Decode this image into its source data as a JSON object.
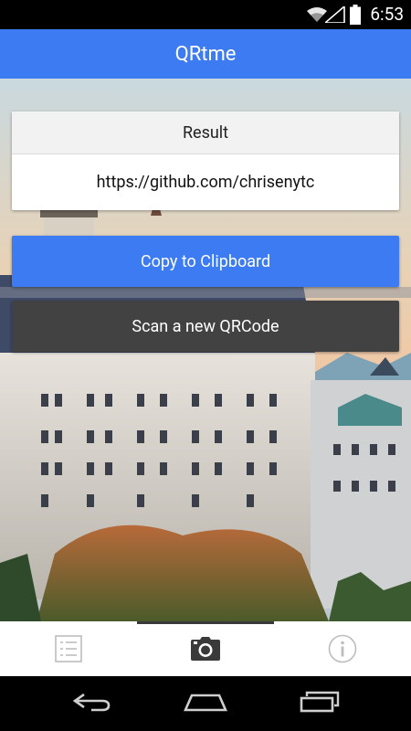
{
  "status_bar": {
    "time": "6:53",
    "icons": [
      "wifi-icon",
      "signal-icon",
      "battery-icon"
    ]
  },
  "app_bar": {
    "title": "QRtme"
  },
  "result": {
    "header": "Result",
    "value": "https://github.com/chrisenytc"
  },
  "buttons": {
    "copy_label": "Copy to Clipboard",
    "scan_label": "Scan a new QRCode"
  },
  "tabs": [
    {
      "icon": "list-icon",
      "selected": false
    },
    {
      "icon": "camera-icon",
      "selected": true
    },
    {
      "icon": "info-icon",
      "selected": false
    }
  ],
  "nav_bar": {
    "icons": [
      "back-icon",
      "home-icon",
      "recents-icon"
    ]
  },
  "colors": {
    "accent": "#3d7bf2",
    "scan_button": "#424242",
    "app_bar_text": "#ffffff"
  }
}
